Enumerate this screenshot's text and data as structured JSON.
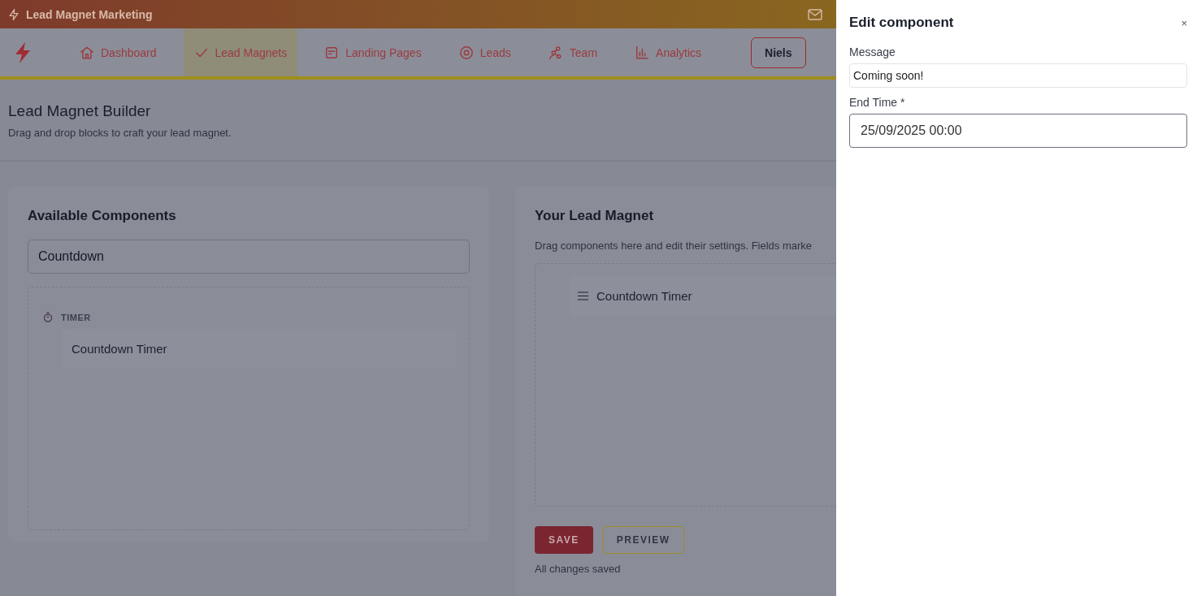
{
  "app_bar": {
    "title": "Lead Magnet Marketing"
  },
  "nav": {
    "items": [
      {
        "label": "Dashboard",
        "kind": "home",
        "selected": false
      },
      {
        "label": "Lead Magnets",
        "kind": "check",
        "selected": true
      },
      {
        "label": "Landing Pages",
        "kind": "page",
        "selected": false
      },
      {
        "label": "Leads",
        "kind": "target",
        "selected": false
      },
      {
        "label": "Team",
        "kind": "team",
        "selected": false
      },
      {
        "label": "Analytics",
        "kind": "chart",
        "selected": false
      }
    ],
    "user_button": "Niels"
  },
  "header": {
    "title": "Lead Magnet Builder",
    "subtitle": "Drag and drop blocks to craft your lead magnet."
  },
  "available": {
    "title": "Available Components",
    "search": {
      "value": "Countdown"
    },
    "groups": [
      {
        "label": "TIMER",
        "items": [
          "Countdown Timer"
        ]
      }
    ]
  },
  "builder": {
    "title": "Your Lead Magnet",
    "description": "Drag components here and edit their settings. Fields marke",
    "blocks": [
      "Countdown Timer"
    ],
    "save": "SAVE",
    "preview": "PREVIEW",
    "status": "All changes saved"
  },
  "drawer": {
    "title": "Edit component",
    "close": "×",
    "fields": [
      {
        "label": "Message",
        "value": "Coming soon!",
        "kind": "text"
      },
      {
        "label": "End Time *",
        "value": "25/09/2025 00:00",
        "kind": "datetime"
      }
    ]
  }
}
